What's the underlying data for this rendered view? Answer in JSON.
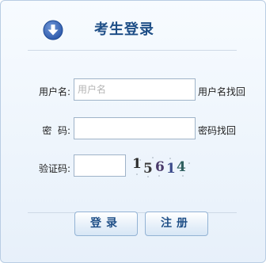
{
  "header": {
    "icon": "download-arrow-icon",
    "title": "考生登录"
  },
  "form": {
    "username": {
      "label": "用户名:",
      "placeholder": "用户名",
      "value": "",
      "link": "用户名找回"
    },
    "password": {
      "label": "密  码:",
      "value": "",
      "link": "密码找回"
    },
    "captcha": {
      "label": "验证码:",
      "value": "",
      "image_text": "15614"
    }
  },
  "buttons": {
    "login": "登录",
    "register": "注册"
  }
}
